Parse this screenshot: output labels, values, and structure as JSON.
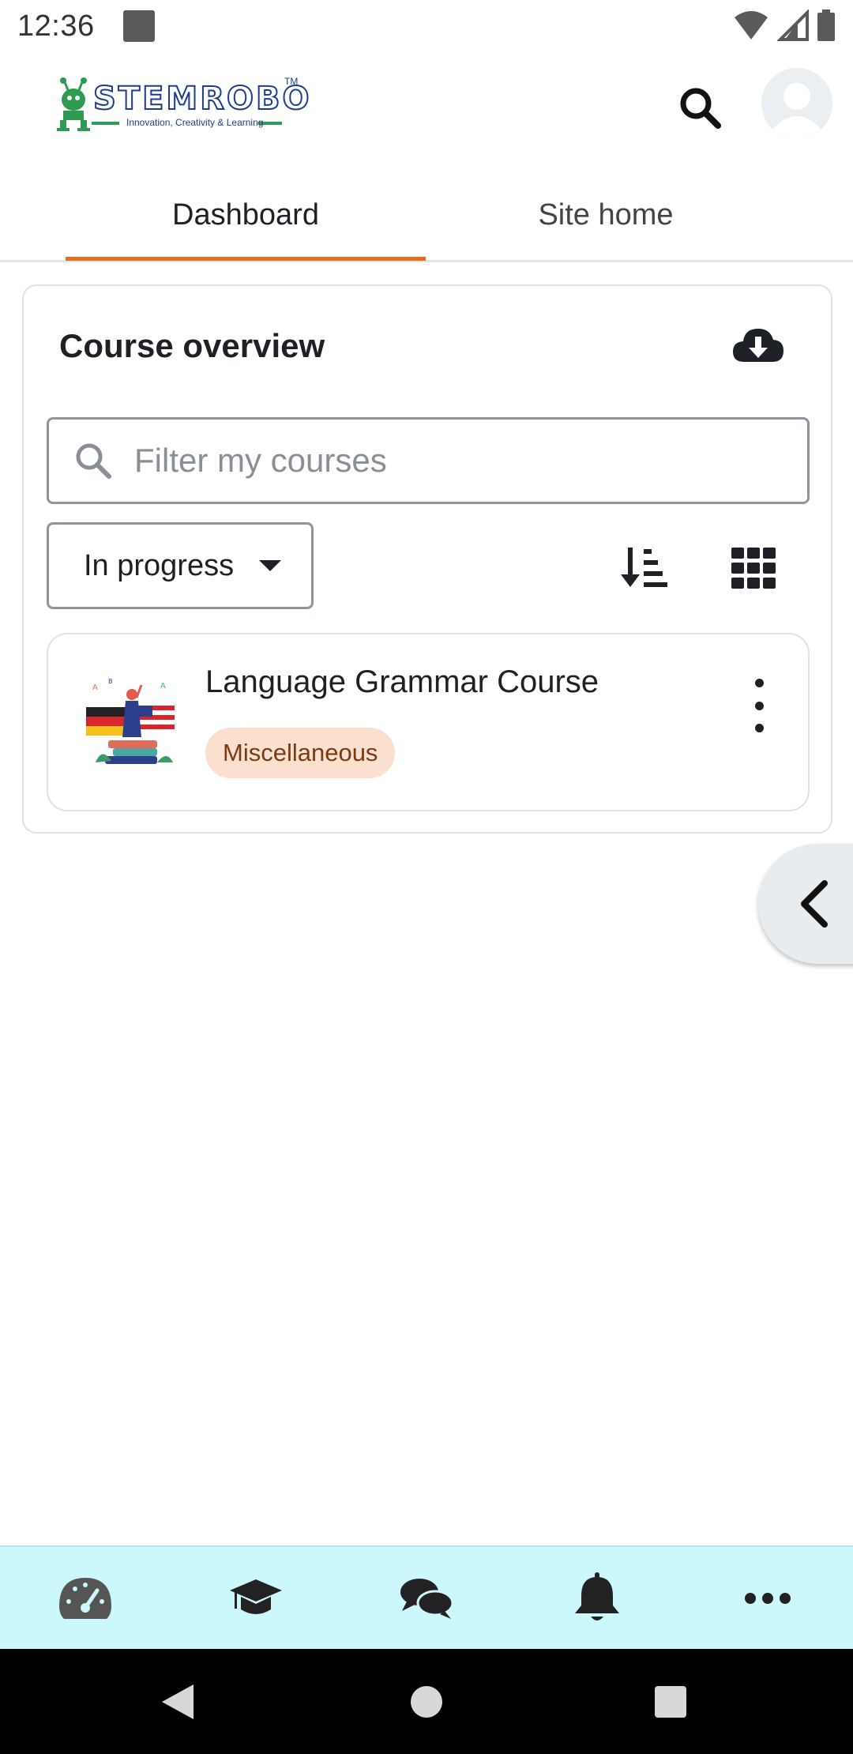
{
  "status_bar": {
    "time": "12:36",
    "icons": [
      "notification-square-icon",
      "wifi-icon",
      "cell-signal-icon",
      "battery-icon"
    ]
  },
  "header": {
    "logo_text": "STEMROBO",
    "logo_trademark": "TM",
    "logo_tagline": "Innovation, Creativity & Learning",
    "icons": [
      "search-icon",
      "user-avatar-icon"
    ]
  },
  "tabs": [
    {
      "label": "Dashboard",
      "active": true
    },
    {
      "label": "Site home",
      "active": false
    }
  ],
  "course_overview": {
    "title": "Course overview",
    "download_icon": "cloud-download-icon",
    "filter_placeholder": "Filter my courses",
    "filter_value": "",
    "status_filter": "In progress",
    "sort_icon": "sort-amount-icon",
    "view_icon": "grid-view-icon",
    "courses": [
      {
        "name": "Language Grammar Course",
        "category": "Miscellaneous"
      }
    ]
  },
  "drawer_handle_icon": "chevron-left-icon",
  "bottom_nav": [
    {
      "name": "dashboard",
      "icon": "gauge-icon"
    },
    {
      "name": "my-courses",
      "icon": "graduation-cap-icon"
    },
    {
      "name": "messages",
      "icon": "comments-icon"
    },
    {
      "name": "notifications",
      "icon": "bell-icon"
    },
    {
      "name": "more",
      "icon": "ellipsis-icon"
    }
  ],
  "colors": {
    "accent": "#e86d1f",
    "bottom_nav_bg": "#ccf8fb",
    "badge_bg": "#fbe0cf",
    "badge_text": "#7a3a14",
    "logo_green": "#2e9a52",
    "logo_blue": "#1d3c8f"
  }
}
